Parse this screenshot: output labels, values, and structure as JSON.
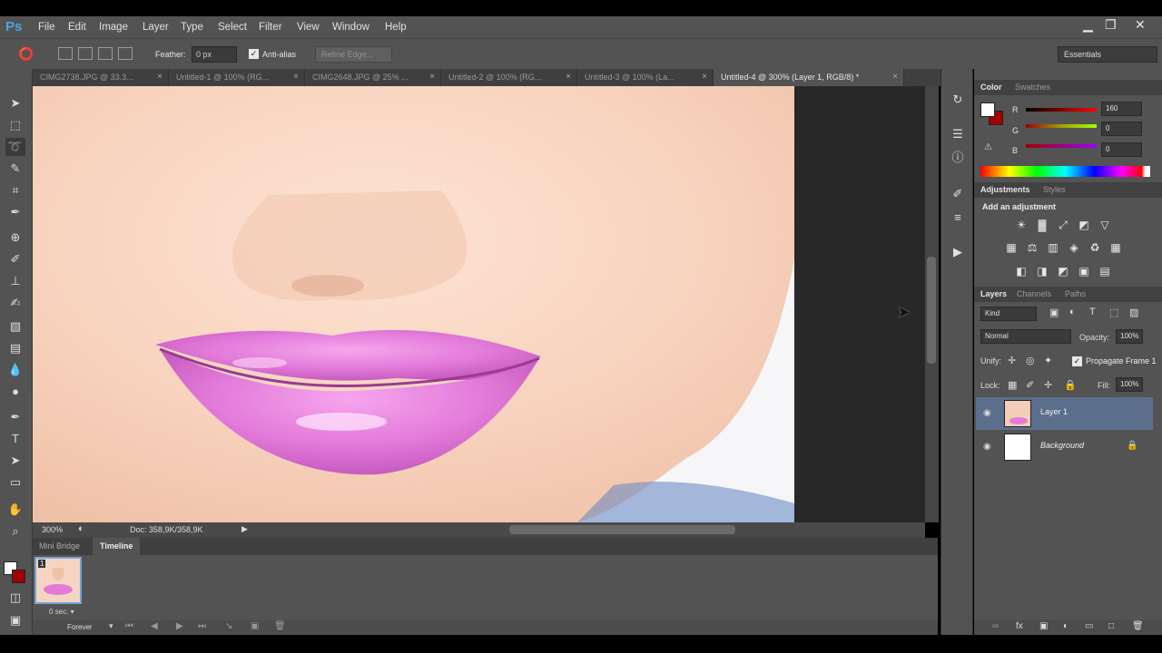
{
  "app": {
    "logo": "Ps"
  },
  "menu": [
    "File",
    "Edit",
    "Image",
    "Layer",
    "Type",
    "Select",
    "Filter",
    "View",
    "Window",
    "Help"
  ],
  "window_controls": {
    "minimize": "▁",
    "restore": "❐",
    "close": "✕"
  },
  "options": {
    "feather_label": "Feather:",
    "feather_value": "0 px",
    "antialias_label": "Anti-alias",
    "refine_label": "Refine Edge...",
    "workspace": "Essentials"
  },
  "tabs": [
    {
      "label": "CIMG2738.JPG @ 33.3..."
    },
    {
      "label": "Untitled-1 @ 100% (RG..."
    },
    {
      "label": "CIMG2648.JPG @ 25% ..."
    },
    {
      "label": "Untitled-2 @ 100% (RG..."
    },
    {
      "label": "Untitled-3 @ 100% (La..."
    },
    {
      "label": "Untitled-4 @ 300% (Layer 1, RGB/8) *"
    }
  ],
  "status": {
    "zoom": "300%",
    "doc": "Doc: 358,9K/358,9K"
  },
  "bottom_tabs": {
    "mini_bridge": "Mini Bridge",
    "timeline": "Timeline"
  },
  "timeline": {
    "frame_number": "1",
    "frame_delay": "0 sec. ▾",
    "loop": "Forever"
  },
  "color_panel": {
    "tabs": [
      "Color",
      "Swatches"
    ],
    "channels": [
      {
        "label": "R",
        "value": "160"
      },
      {
        "label": "G",
        "value": "0"
      },
      {
        "label": "B",
        "value": "0"
      }
    ],
    "foreground": "#a00000",
    "background": "#ffffff"
  },
  "adjustments": {
    "tabs": [
      "Adjustments",
      "Styles"
    ],
    "title": "Add an adjustment"
  },
  "layers_panel": {
    "tabs": [
      "Layers",
      "Channels",
      "Paths"
    ],
    "kind": "Kind",
    "blend_mode": "Normal",
    "opacity_label": "Opacity:",
    "opacity_value": "100%",
    "unify_label": "Unify:",
    "propagate_label": "Propagate Frame 1",
    "lock_label": "Lock:",
    "fill_label": "Fill:",
    "fill_value": "100%",
    "layers": [
      {
        "name": "Layer 1",
        "selected": true
      },
      {
        "name": "Background",
        "selected": false
      }
    ]
  }
}
